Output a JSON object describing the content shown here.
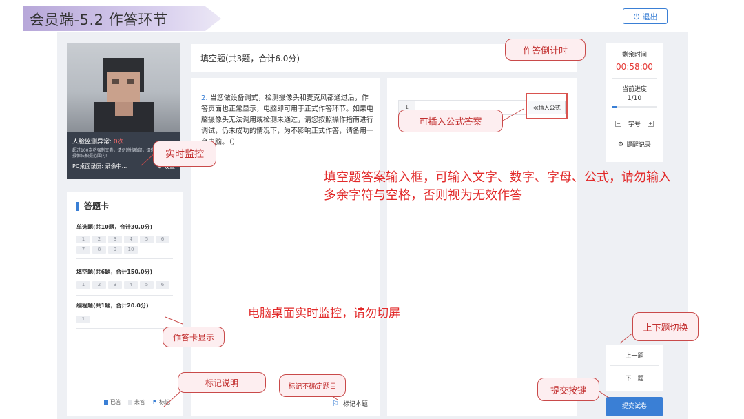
{
  "header": {
    "title": "会员端-5.2  作答环节",
    "exit_label": "退出"
  },
  "camera": {
    "face_label": "人脸监测异常: ",
    "face_count": "0次",
    "warning": "超过100次将强制交卷，请勿遮挡脸部，请您的正脸在摄像头拍摄范围内!",
    "screen_label": "PC桌面录屏: 录像中...",
    "settings_label": "设置"
  },
  "answer_card": {
    "title": "答题卡",
    "sections": [
      {
        "title": "单选题(共10题，合计30.0分)",
        "numbers": [
          "1",
          "2",
          "3",
          "4",
          "5",
          "6",
          "7",
          "8",
          "9",
          "10"
        ]
      },
      {
        "title": "填空题(共6题，合计150.0分)",
        "numbers": [
          "1",
          "2",
          "3",
          "4",
          "5",
          "6"
        ]
      },
      {
        "title": "编程题(共1题，合计20.0分)",
        "numbers": [
          "1"
        ]
      }
    ],
    "legend": {
      "answered": "已答",
      "unanswered": "未答",
      "marked": "标记"
    }
  },
  "question": {
    "header": "填空题(共3题，合计6.0分)",
    "number": "2.",
    "text": "当您做设备调式，检测摄像头和麦克风都通过后，作答页面也正常显示，电脑即可用于正式作答环节。如果电脑摄像头无法调用或检测未通过，请您按照操作指南进行调试，仍未成功的情况下，为不影响正式作答，请备用一台电脑。（）",
    "mark_label": "标记本题"
  },
  "answer": {
    "line_number": "1",
    "formula_label": "≪插入公式"
  },
  "sidebar": {
    "remaining_label": "剩余时间",
    "remaining_time": "00:58:00",
    "progress_label": "当前进度",
    "progress_value": "1/10",
    "progress_fraction": 0.1,
    "font_label": "字号",
    "reminder_label": "提醒记录",
    "prev_label": "上一题",
    "next_label": "下一题",
    "submit_label": "提交试卷"
  },
  "annotations": {
    "countdown": "作答倒计时",
    "formula": "可插入公式答案",
    "monitor": "实时监控",
    "input_note": "填空题答案输入框，可输入文字、数字、字母、公式，请勿输入多余字符与空格，否则视为无效作答",
    "desktop_note": "电脑桌面实时监控，请勿切屏",
    "card_display": "作答卡显示",
    "nav_switch": "上下题切换",
    "mark_note": "标记说明",
    "mark_uncertain": "标记不确定题目",
    "submit_key": "提交按键"
  },
  "colors": {
    "accent": "#3a7fd5",
    "alert": "#e53935",
    "annotation": "#e22a2a"
  }
}
